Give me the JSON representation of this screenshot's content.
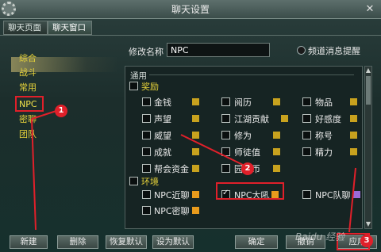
{
  "window": {
    "title": "聊天设置",
    "close": "✕"
  },
  "tabs": [
    {
      "label": "聊天页面"
    },
    {
      "label": "聊天窗口"
    }
  ],
  "sidebar": {
    "items": [
      {
        "label": "综合"
      },
      {
        "label": "战斗"
      },
      {
        "label": "常用"
      },
      {
        "label": "NPC"
      },
      {
        "label": "密聊"
      },
      {
        "label": "团队"
      }
    ],
    "selected": "NPC"
  },
  "name": {
    "label": "修改名称",
    "value": "NPC"
  },
  "channel_alert": {
    "label": "频道消息提醒"
  },
  "panel": {
    "section_general": "通用",
    "reward": {
      "title": "奖励",
      "items": [
        {
          "label": "金钱",
          "color": "#c8a21e"
        },
        {
          "label": "阅历",
          "color": "#c8a21e"
        },
        {
          "label": "物品",
          "color": "#c8a21e"
        },
        {
          "label": "声望",
          "color": "#c8a21e"
        },
        {
          "label": "江湖贡献",
          "color": "#c8a21e"
        },
        {
          "label": "好感度",
          "color": "#c8a21e"
        },
        {
          "label": "威望",
          "color": "#c8a21e"
        },
        {
          "label": "修为",
          "color": "#c8a21e"
        },
        {
          "label": "称号",
          "color": "#c8a21e"
        },
        {
          "label": "成就",
          "color": "#c8a21e"
        },
        {
          "label": "师徒值",
          "color": "#c8a21e"
        },
        {
          "label": "精力",
          "color": "#c8a21e"
        },
        {
          "label": "帮会资金",
          "color": "#c8a21e"
        },
        {
          "label": "园宅币",
          "color": "#c8a21e"
        }
      ]
    },
    "env": {
      "title": "环境",
      "items": [
        {
          "label": "NPC近聊",
          "color": "#e89b1c",
          "checked": false
        },
        {
          "label": "NPC大吼",
          "color": "#e89b1c",
          "checked": true
        },
        {
          "label": "NPC队聊",
          "color": "#9b6ad8",
          "checked": false
        },
        {
          "label": "NPC密聊",
          "color": "#e89b1c",
          "checked": false
        }
      ]
    }
  },
  "buttons": {
    "new": "新建",
    "delete": "删除",
    "restore": "恢复默认",
    "set_default": "设为默认",
    "ok": "确定",
    "cancel": "撤销",
    "apply": "应用"
  },
  "annotations": {
    "one": "1",
    "two": "2",
    "three": "3"
  },
  "watermark": "Baidu 经验",
  "colors": {
    "accent_yellow": "#e6d23a",
    "annotation_red": "#e0202a"
  }
}
